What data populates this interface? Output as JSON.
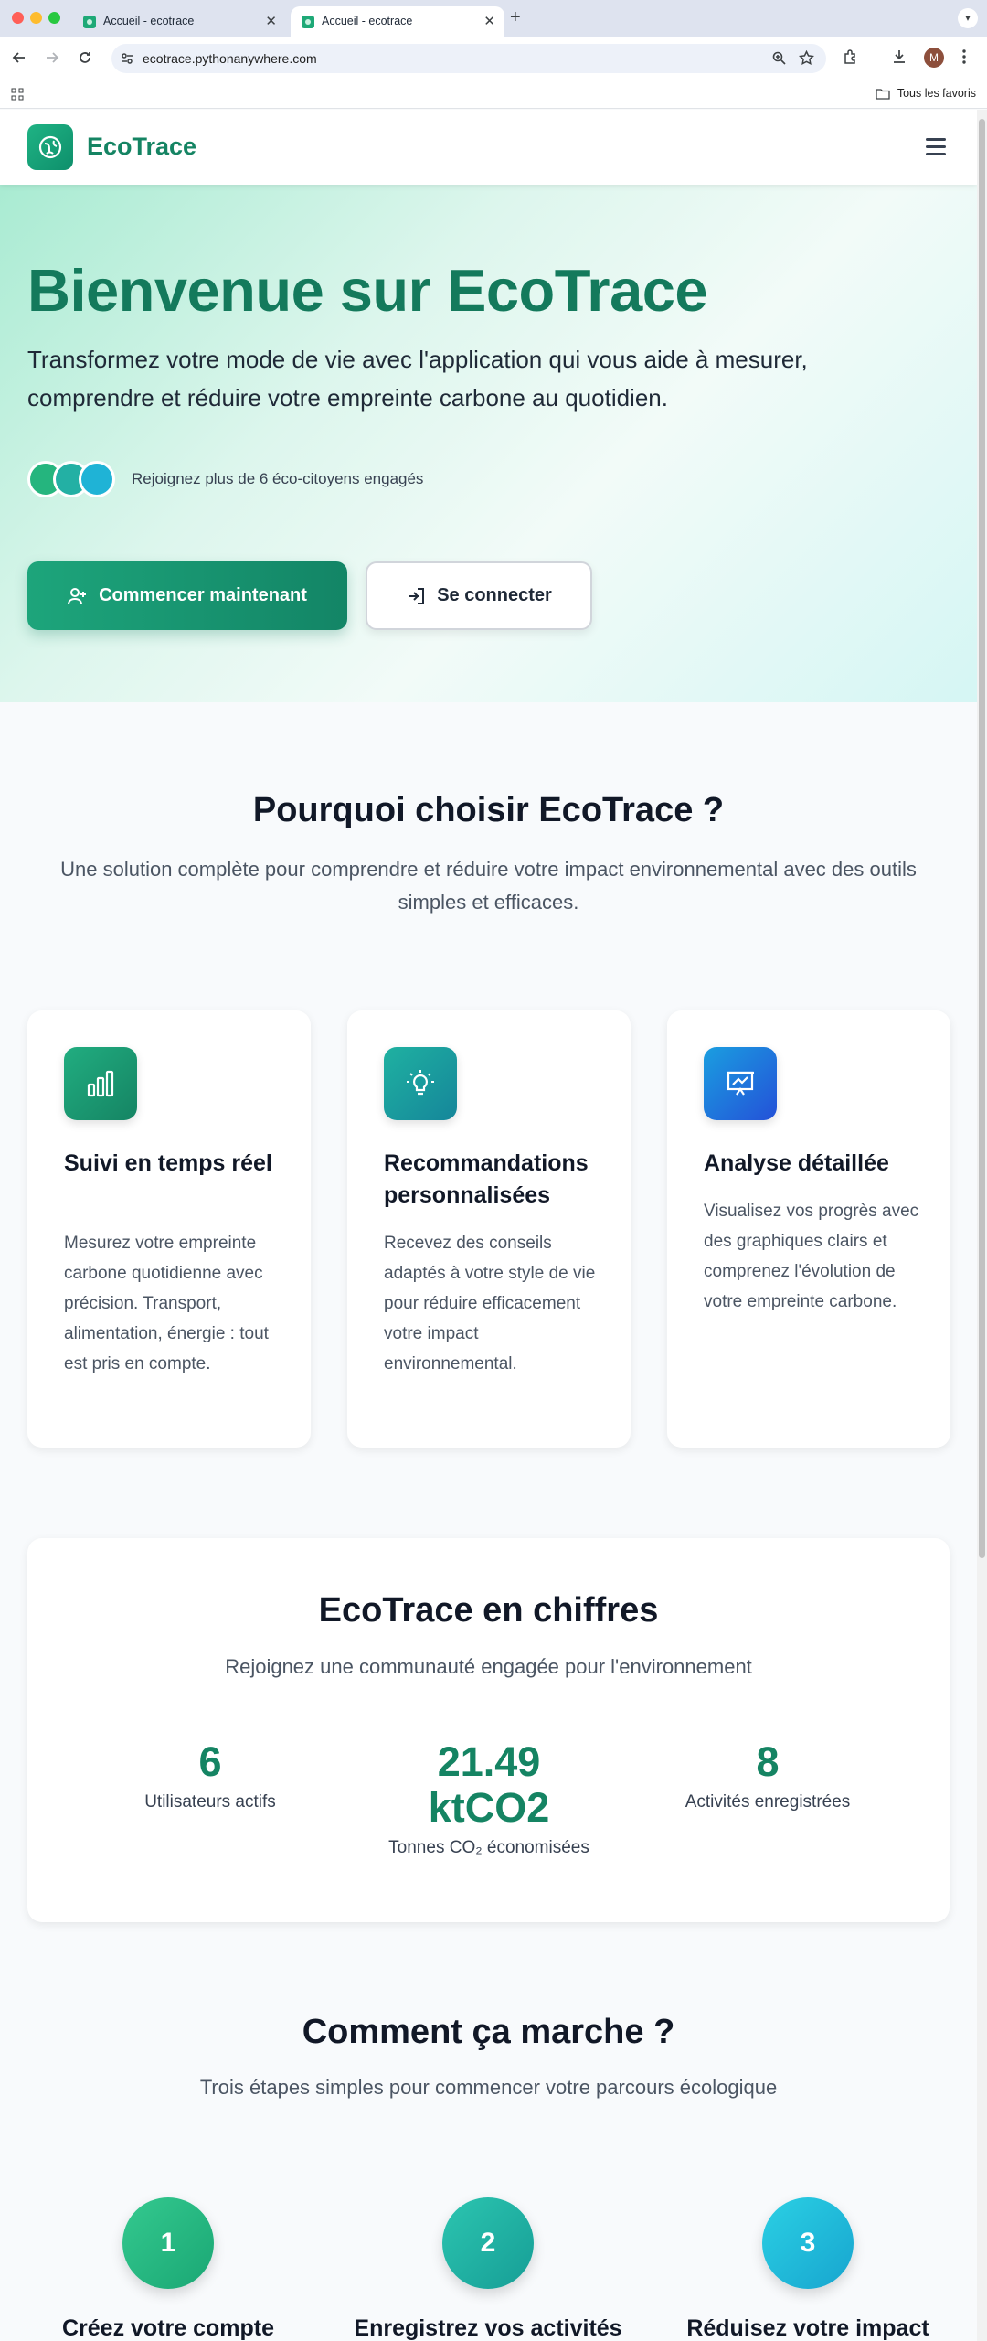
{
  "browser": {
    "tabs": [
      {
        "title": "Accueil - ecotrace"
      },
      {
        "title": "Accueil - ecotrace"
      }
    ],
    "url": "ecotrace.pythonanywhere.com",
    "profile_initial": "M",
    "bookmarks_folder": "Tous les favoris"
  },
  "nav": {
    "brand": "EcoTrace"
  },
  "hero": {
    "title": "Bienvenue sur EcoTrace",
    "lead": "Transformez votre mode de vie avec l'application qui vous aide à mesurer, comprendre et réduire votre empreinte carbone au quotidien.",
    "social_proof": "Rejoignez plus de 6 éco-citoyens engagés",
    "primary_button": "Commencer maintenant",
    "secondary_button": "Se connecter"
  },
  "features": {
    "title": "Pourquoi choisir EcoTrace ?",
    "subtitle": "Une solution complète pour comprendre et réduire votre impact environnemental avec des outils simples et efficaces.",
    "cards": [
      {
        "title": "Suivi en temps réel",
        "text": "Mesurez votre empreinte carbone quotidienne avec précision. Transport, alimentation, énergie : tout est pris en compte.",
        "icon": "bar-chart-icon",
        "color": "#1a9b74"
      },
      {
        "title": "Recommandations personnalisées",
        "text": "Recevez des conseils adaptés à votre style de vie pour réduire efficacement votre impact environnemental.",
        "icon": "lightbulb-icon",
        "color": "#1aa39a"
      },
      {
        "title": "Analyse détaillée",
        "text": "Visualisez vos progrès avec des graphiques clairs et comprenez l'évolution de votre empreinte carbone.",
        "icon": "presentation-chart-icon",
        "color": "#1d6be0"
      }
    ]
  },
  "stats": {
    "title": "EcoTrace en chiffres",
    "subtitle": "Rejoignez une communauté engagée pour l'environnement",
    "items": [
      {
        "value": "6",
        "label": "Utilisateurs actifs"
      },
      {
        "value_line1": "21.49",
        "value_line2": "ktCO2",
        "label": "Tonnes CO₂ économisées"
      },
      {
        "value": "8",
        "label": "Activités enregistrées"
      }
    ]
  },
  "steps": {
    "title": "Comment ça marche ?",
    "subtitle": "Trois étapes simples pour commencer votre parcours écologique",
    "items": [
      {
        "number": "1",
        "title": "Créez votre compte",
        "color": "#23b582"
      },
      {
        "number": "2",
        "title": "Enregistrez vos activités",
        "color": "#1fb3a5"
      },
      {
        "number": "3",
        "title": "Réduisez votre impact",
        "color": "#1cb6d6"
      }
    ]
  }
}
